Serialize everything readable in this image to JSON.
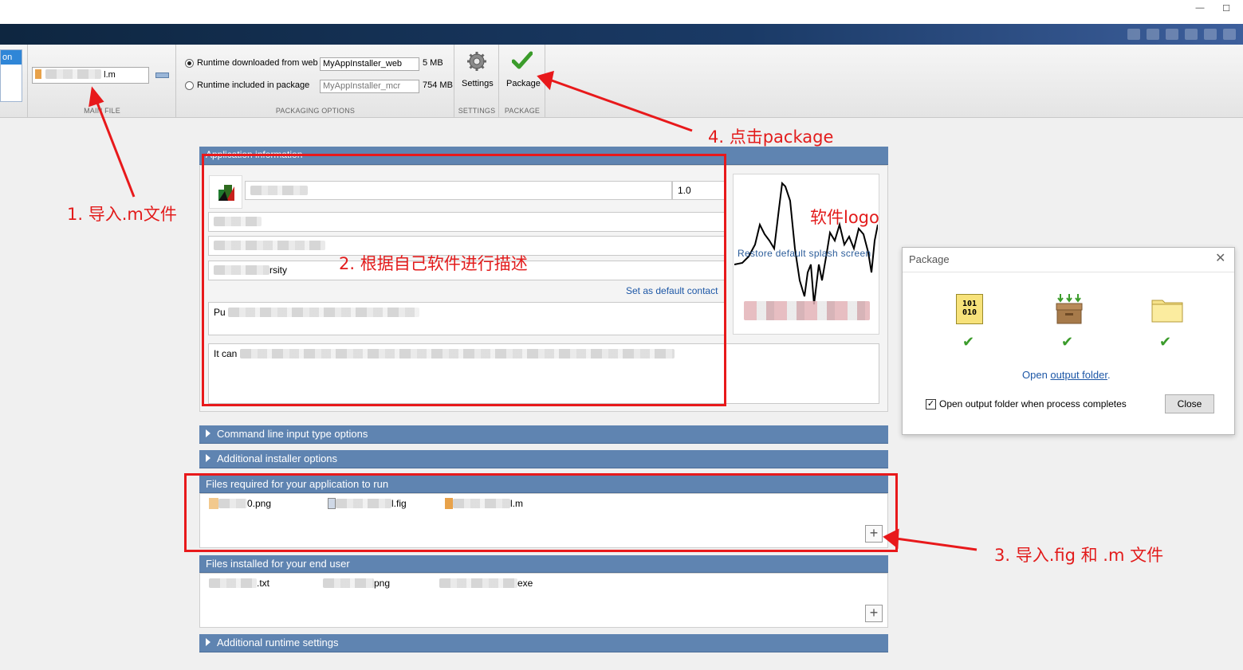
{
  "window": {
    "minimize": "—",
    "maximize": "☐"
  },
  "toolstrip": {
    "left_tab_partial": "on",
    "main_file": {
      "value": "l.m",
      "section_label": "MAIN FILE"
    },
    "packaging": {
      "option_web_label": "Runtime downloaded from web",
      "option_web_value": "MyAppInstaller_web",
      "option_web_size": "5 MB",
      "option_pkg_label": "Runtime included in package",
      "option_pkg_value": "MyAppInstaller_mcr",
      "option_pkg_size": "754 MB",
      "section_label": "PACKAGING OPTIONS"
    },
    "settings": {
      "label": "Settings",
      "section_label": "SETTINGS"
    },
    "package": {
      "label": "Package",
      "section_label": "PACKAGE"
    }
  },
  "app_info": {
    "header": "Application information",
    "version": "1.0",
    "org_suffix": "rsity",
    "set_default_contact": "Set as default contact",
    "summary_prefix": "Pu",
    "description_prefix": "It can",
    "restore_splash": "Restore default splash screen"
  },
  "sections": {
    "command_line": "Command line input type options",
    "installer": "Additional installer options",
    "files_required": "Files required for your application to run",
    "files_installed": "Files installed for your end user",
    "runtime": "Additional runtime settings"
  },
  "files_required": [
    {
      "name": "0.png"
    },
    {
      "name": "l.fig"
    },
    {
      "name": "l.m"
    }
  ],
  "files_installed": [
    {
      "name": ".txt"
    },
    {
      "name": "png"
    },
    {
      "name": "exe"
    }
  ],
  "annotations": {
    "step1": "1. 导入.m文件",
    "step2": "2. 根据自己软件进行描述",
    "step3": "3. 导入.fig 和 .m 文件",
    "step4": "4. 点击package",
    "logo": "软件logo"
  },
  "dialog": {
    "title": "Package",
    "icon1_text": "101\n010",
    "open_text": "Open ",
    "open_link": "output folder",
    "open_suffix": ".",
    "checkbox_label": "Open output folder when process completes",
    "close_label": "Close"
  },
  "colors": {
    "panel_header": "#5f84b1",
    "annotation": "#e21b1b",
    "link": "#1d57a6"
  }
}
